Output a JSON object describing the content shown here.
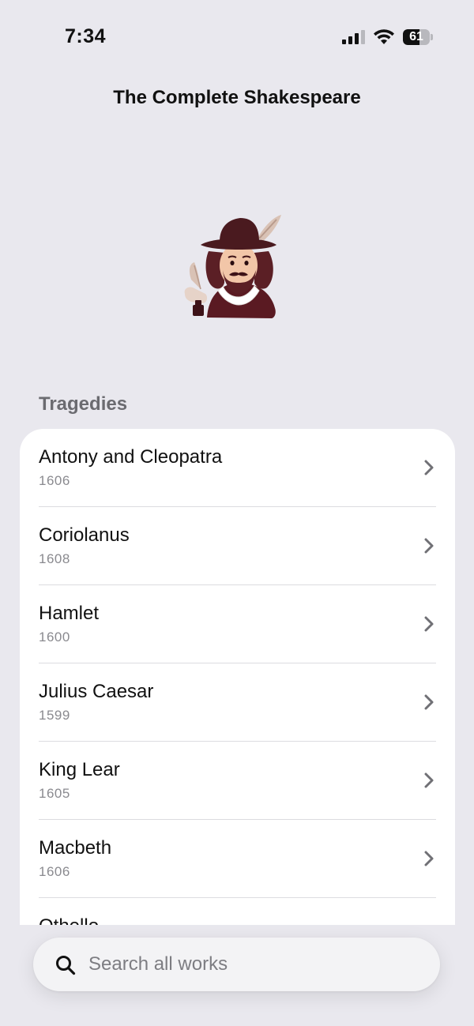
{
  "status_bar": {
    "time": "7:34",
    "battery": "61",
    "battery_level": 0.61,
    "icons": [
      "cellular-signal-icon",
      "wifi-icon",
      "battery-icon"
    ]
  },
  "header": {
    "title": "The Complete Shakespeare"
  },
  "portrait": {
    "icon": "shakespeare-portrait-icon",
    "colors": {
      "hat": "#4a1a1f",
      "hair": "#5b1f25",
      "skin": "#f2c6a8",
      "coat": "#5a1a22",
      "quill": "#d9c2b5"
    }
  },
  "section": {
    "header": "Tragedies",
    "items": [
      {
        "title": "Antony and Cleopatra",
        "year": "1606"
      },
      {
        "title": "Coriolanus",
        "year": "1608"
      },
      {
        "title": "Hamlet",
        "year": "1600"
      },
      {
        "title": "Julius Caesar",
        "year": "1599"
      },
      {
        "title": "King Lear",
        "year": "1605"
      },
      {
        "title": "Macbeth",
        "year": "1606"
      },
      {
        "title": "Othello",
        "year": ""
      }
    ]
  },
  "search": {
    "placeholder": "Search all works",
    "value": ""
  },
  "colors": {
    "background": "#e9e8ee",
    "card": "#ffffff",
    "secondary_text": "#8a8a8f",
    "section_header": "#6b6b70"
  }
}
